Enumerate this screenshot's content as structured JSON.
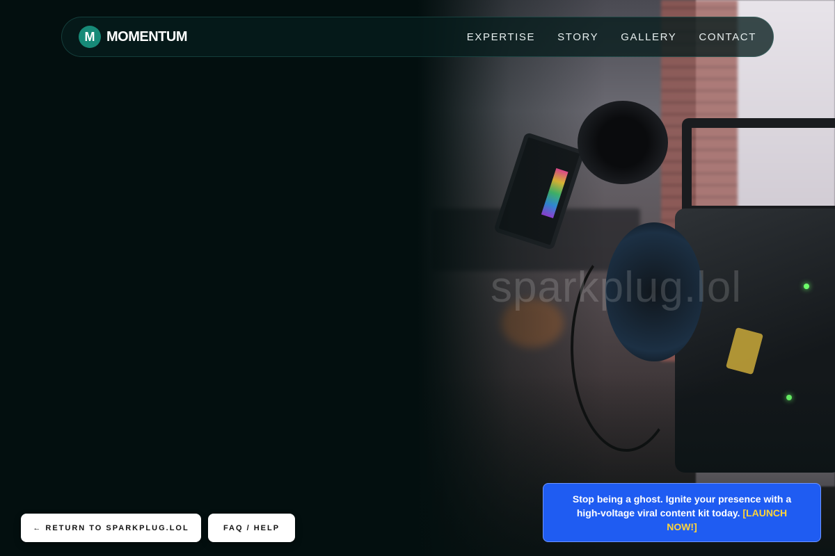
{
  "brand": {
    "mark": "M",
    "name": "MOMENTUM"
  },
  "nav": {
    "items": [
      {
        "label": "EXPERTISE"
      },
      {
        "label": "STORY"
      },
      {
        "label": "GALLERY"
      },
      {
        "label": "CONTACT"
      }
    ]
  },
  "hero": {
    "watermark": "sparkplug.lol",
    "image": "camera-rig-photo"
  },
  "footer_buttons": {
    "return_label": "← RETURN TO SPARKPLUG.LOL",
    "faq_label": "FAQ / HELP"
  },
  "promo": {
    "text": "Stop being a ghost. Ignite your presence with a high-voltage viral content kit today.",
    "cta": "[LAUNCH NOW!]"
  },
  "colors": {
    "background": "#030f0f",
    "accent": "#178a78",
    "promo_bg": "#1f5cf2",
    "promo_cta": "#ffd43a"
  }
}
